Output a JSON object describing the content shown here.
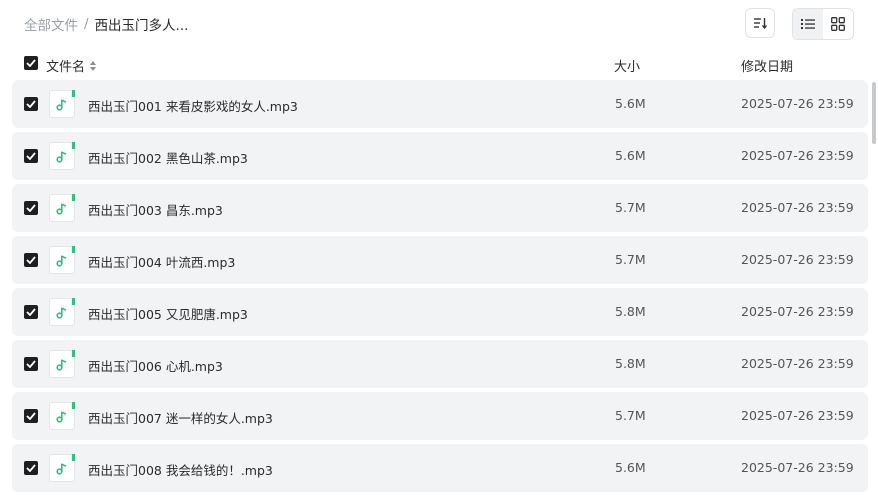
{
  "breadcrumb": {
    "root": "全部文件",
    "separator": "/",
    "current": "西出玉门多人..."
  },
  "header": {
    "name": "文件名",
    "size": "大小",
    "modified": "修改日期"
  },
  "colors": {
    "accent": "#2ec27e",
    "checkbox": "#1f1f1f",
    "row_bg": "#f2f3f5"
  },
  "files": [
    {
      "name": "西出玉门001 来看皮影戏的女人.mp3",
      "size": "5.6M",
      "modified": "2025-07-26 23:59",
      "checked": true
    },
    {
      "name": "西出玉门002 黑色山茶.mp3",
      "size": "5.6M",
      "modified": "2025-07-26 23:59",
      "checked": true
    },
    {
      "name": "西出玉门003 昌东.mp3",
      "size": "5.7M",
      "modified": "2025-07-26 23:59",
      "checked": true
    },
    {
      "name": "西出玉门004 叶流西.mp3",
      "size": "5.7M",
      "modified": "2025-07-26 23:59",
      "checked": true
    },
    {
      "name": "西出玉门005 又见肥唐.mp3",
      "size": "5.8M",
      "modified": "2025-07-26 23:59",
      "checked": true
    },
    {
      "name": "西出玉门006 心机.mp3",
      "size": "5.8M",
      "modified": "2025-07-26 23:59",
      "checked": true
    },
    {
      "name": "西出玉门007 迷一样的女人.mp3",
      "size": "5.7M",
      "modified": "2025-07-26 23:59",
      "checked": true
    },
    {
      "name": "西出玉门008 我会给钱的！.mp3",
      "size": "5.6M",
      "modified": "2025-07-26 23:59",
      "checked": true
    }
  ]
}
